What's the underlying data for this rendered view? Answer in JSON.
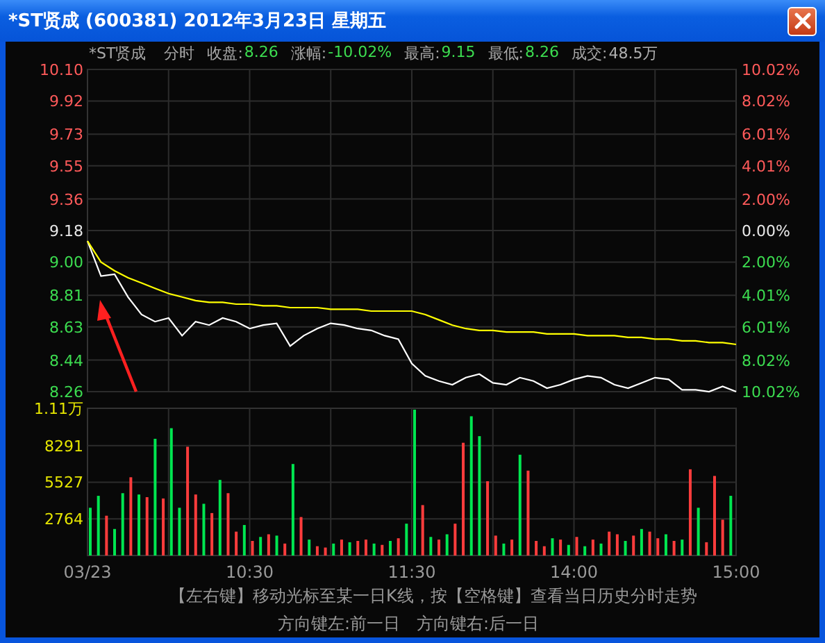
{
  "window": {
    "title": "*ST贤成 (600381) 2012年3月23日 星期五"
  },
  "quote_bar": {
    "name": "*ST贤成",
    "mode": "分时",
    "fields": [
      {
        "label": "收盘:",
        "value": "8.26",
        "color": "#3cdc50"
      },
      {
        "label": "涨幅:",
        "value": "-10.02%",
        "color": "#3cdc50"
      },
      {
        "label": "最高:",
        "value": "9.15",
        "color": "#3cdc50"
      },
      {
        "label": "最低:",
        "value": "8.26",
        "color": "#3cdc50"
      },
      {
        "label": "成交:",
        "value": "48.5万",
        "color": "#b0b0b0"
      }
    ]
  },
  "price_chart": {
    "percent_labels": [
      {
        "label": "10.02%",
        "color": "#ff5a5a"
      },
      {
        "label": "8.02%",
        "color": "#ff5a5a"
      },
      {
        "label": "6.01%",
        "color": "#ff5a5a"
      },
      {
        "label": "4.01%",
        "color": "#ff5a5a"
      },
      {
        "label": "2.00%",
        "color": "#ff5a5a"
      },
      {
        "label": "0.00%",
        "color": "#e8e8e8"
      },
      {
        "label": "2.00%",
        "color": "#3cdc50"
      },
      {
        "label": "4.01%",
        "color": "#3cdc50"
      },
      {
        "label": "6.01%",
        "color": "#3cdc50"
      },
      {
        "label": "8.02%",
        "color": "#3cdc50"
      },
      {
        "label": "10.02%",
        "color": "#3cdc50"
      }
    ],
    "chart_data": {
      "type": "line",
      "grid": true,
      "ylim": [
        8.26,
        10.1
      ],
      "yticks": [
        {
          "value": 10.1,
          "label": "10.10"
        },
        {
          "value": 9.92,
          "label": "9.92"
        },
        {
          "value": 9.73,
          "label": "9.73"
        },
        {
          "value": 9.55,
          "label": "9.55"
        },
        {
          "value": 9.36,
          "label": "9.36"
        },
        {
          "value": 9.18,
          "label": "9.18"
        },
        {
          "value": 9.0,
          "label": "9.00"
        },
        {
          "value": 8.81,
          "label": "8.81"
        },
        {
          "value": 8.63,
          "label": "8.63"
        },
        {
          "value": 8.44,
          "label": "8.44"
        },
        {
          "value": 8.26,
          "label": "8.26"
        }
      ],
      "series": [
        {
          "color": "#ffffff",
          "values": [
            9.12,
            8.92,
            8.93,
            8.8,
            8.7,
            8.66,
            8.68,
            8.58,
            8.66,
            8.64,
            8.68,
            8.66,
            8.62,
            8.64,
            8.65,
            8.52,
            8.58,
            8.62,
            8.65,
            8.64,
            8.62,
            8.61,
            8.58,
            8.56,
            8.42,
            8.35,
            8.32,
            8.3,
            8.34,
            8.36,
            8.31,
            8.3,
            8.34,
            8.32,
            8.28,
            8.3,
            8.33,
            8.35,
            8.34,
            8.3,
            8.28,
            8.31,
            8.34,
            8.33,
            8.27,
            8.27,
            8.26,
            8.29,
            8.26
          ]
        },
        {
          "color": "#ffff00",
          "values": [
            9.12,
            9.0,
            8.95,
            8.91,
            8.88,
            8.85,
            8.82,
            8.8,
            8.78,
            8.77,
            8.77,
            8.76,
            8.76,
            8.75,
            8.75,
            8.74,
            8.74,
            8.74,
            8.73,
            8.73,
            8.73,
            8.72,
            8.72,
            8.72,
            8.72,
            8.7,
            8.67,
            8.64,
            8.62,
            8.61,
            8.61,
            8.6,
            8.6,
            8.6,
            8.59,
            8.59,
            8.59,
            8.58,
            8.58,
            8.58,
            8.57,
            8.57,
            8.56,
            8.56,
            8.55,
            8.55,
            8.54,
            8.54,
            8.53
          ]
        }
      ]
    }
  },
  "volume_chart": {
    "top_label": "1.11万",
    "chart_data": {
      "type": "bar",
      "categories": [
        "03/23",
        null,
        null,
        null,
        null,
        null,
        null,
        null,
        null,
        null,
        null,
        null,
        null,
        null,
        null,
        null,
        null,
        null,
        null,
        null,
        "10:30",
        null,
        null,
        null,
        null,
        null,
        null,
        null,
        null,
        null,
        null,
        null,
        null,
        null,
        null,
        null,
        null,
        null,
        null,
        null,
        "11:30",
        null,
        null,
        null,
        null,
        null,
        null,
        null,
        null,
        null,
        null,
        null,
        null,
        null,
        null,
        null,
        null,
        null,
        null,
        null,
        "14:00",
        null,
        null,
        null,
        null,
        null,
        null,
        null,
        null,
        null,
        null,
        null,
        null,
        null,
        null,
        null,
        null,
        null,
        null,
        null,
        "15:00"
      ],
      "ylim": [
        0,
        11100
      ],
      "grid": true,
      "yticks": [
        {
          "value": 2764,
          "label": "2764"
        },
        {
          "value": 5527,
          "label": "5527"
        },
        {
          "value": 8291,
          "label": "8291"
        }
      ],
      "series": [
        {
          "color": "#ff3c3c",
          "values": [
            null,
            null,
            3000,
            null,
            null,
            5900,
            null,
            4400,
            null,
            4300,
            null,
            null,
            8200,
            4600,
            null,
            3200,
            null,
            4700,
            1800,
            null,
            1100,
            null,
            1600,
            null,
            900,
            null,
            2900,
            null,
            700,
            600,
            null,
            1200,
            null,
            1100,
            1200,
            null,
            800,
            null,
            1300,
            null,
            null,
            3800,
            null,
            1200,
            null,
            2400,
            8500,
            null,
            null,
            5600,
            1500,
            null,
            1200,
            null,
            6400,
            1100,
            700,
            null,
            1200,
            null,
            1400,
            null,
            1200,
            null,
            1800,
            1600,
            null,
            1500,
            null,
            1800,
            1300,
            null,
            1100,
            null,
            6500,
            null,
            1000,
            6000,
            2700,
            null,
            null
          ]
        },
        {
          "color": "#00e650",
          "values": [
            3600,
            4500,
            null,
            2000,
            4700,
            null,
            4600,
            null,
            8800,
            null,
            9600,
            3600,
            null,
            null,
            3900,
            null,
            5700,
            null,
            null,
            2300,
            null,
            1400,
            null,
            1500,
            null,
            6900,
            null,
            1200,
            null,
            null,
            900,
            null,
            1000,
            null,
            null,
            900,
            null,
            1100,
            null,
            2400,
            11000,
            null,
            1400,
            null,
            1600,
            null,
            null,
            10500,
            9000,
            null,
            null,
            900,
            null,
            7600,
            null,
            null,
            null,
            1300,
            null,
            800,
            null,
            700,
            null,
            900,
            null,
            null,
            1100,
            null,
            2000,
            null,
            null,
            1600,
            null,
            1200,
            null,
            3600,
            null,
            null,
            null,
            4500,
            null
          ]
        }
      ]
    }
  },
  "hint_lines": [
    [
      "【左右键】移动光标至某一日K线，按【空格键】查看当日历史分时走势"
    ],
    [
      "方向键左:前一日",
      "方向键右:后一日"
    ]
  ]
}
